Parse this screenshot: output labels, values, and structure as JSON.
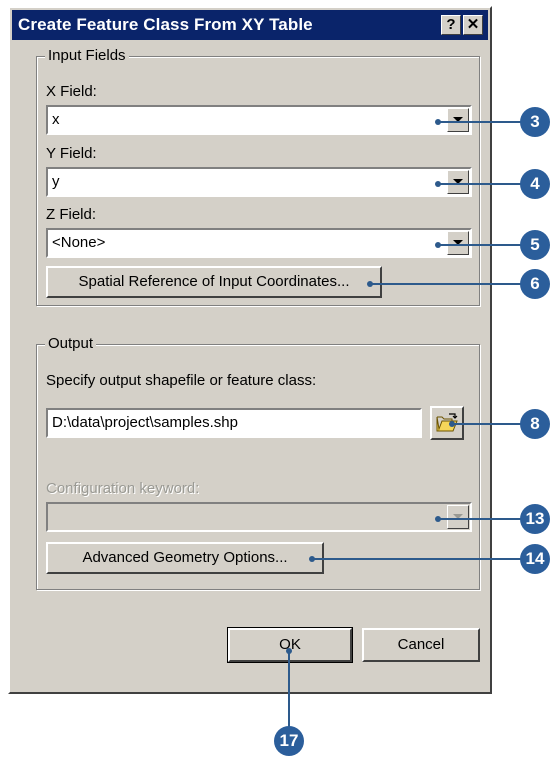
{
  "window": {
    "title": "Create Feature Class From XY Table",
    "help_glyph": "?",
    "close_glyph": "✕"
  },
  "input_fields": {
    "group_label": "Input Fields",
    "x_label": "X Field:",
    "x_value": "x",
    "y_label": "Y Field:",
    "y_value": "y",
    "z_label": "Z Field:",
    "z_value": "<None>",
    "spatial_ref_button": "Spatial Reference of Input Coordinates..."
  },
  "output": {
    "group_label": "Output",
    "prompt": "Specify output shapefile or feature class:",
    "path_value": "D:\\data\\project\\samples.shp",
    "config_label": "Configuration keyword:",
    "config_value": "",
    "advanced_button": "Advanced Geometry Options..."
  },
  "footer": {
    "ok_label": "OK",
    "cancel_label": "Cancel"
  },
  "callouts": {
    "c3": "3",
    "c4": "4",
    "c5": "5",
    "c6": "6",
    "c8": "8",
    "c13": "13",
    "c14": "14",
    "c17": "17"
  },
  "colors": {
    "title_bar": "#0a246a",
    "dialog_face": "#d4d0c8",
    "callout": "#2b5e9b"
  },
  "icons": {
    "open_folder": "folder-open-icon"
  }
}
